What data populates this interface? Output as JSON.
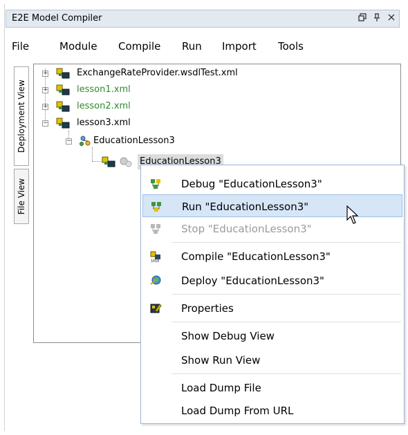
{
  "window": {
    "title": "E2E Model Compiler",
    "controls": {
      "float": "🗗",
      "pin": "ᵖ",
      "close": "✕"
    }
  },
  "menubar": [
    "File",
    "Module",
    "Compile",
    "Run",
    "Import",
    "Tools"
  ],
  "side_tabs": {
    "deployment": "Deployment View",
    "file": "File View"
  },
  "tree": {
    "nodes": [
      {
        "label": "ExchangeRateProvider.wsdlTest.xml"
      },
      {
        "label": "lesson1.xml"
      },
      {
        "label": "lesson2.xml"
      },
      {
        "label": "lesson3.xml"
      },
      {
        "label": "EducationLesson3"
      },
      {
        "label": "EducationLesson3"
      }
    ]
  },
  "context_menu": {
    "items": [
      {
        "label": "Debug \"EducationLesson3\""
      },
      {
        "label": "Run \"EducationLesson3\""
      },
      {
        "label": "Stop \"EducationLesson3\""
      },
      {
        "label": "Compile \"EducationLesson3\""
      },
      {
        "label": "Deploy \"EducationLesson3\""
      },
      {
        "label": "Properties"
      },
      {
        "label": "Show Debug View"
      },
      {
        "label": "Show Run View"
      },
      {
        "label": "Load Dump File"
      },
      {
        "label": "Load Dump From URL"
      }
    ]
  },
  "colors": {
    "green_file": "#2e8b2e",
    "highlight": "#d6e6f7",
    "title_bg": "#e3e9f1"
  }
}
